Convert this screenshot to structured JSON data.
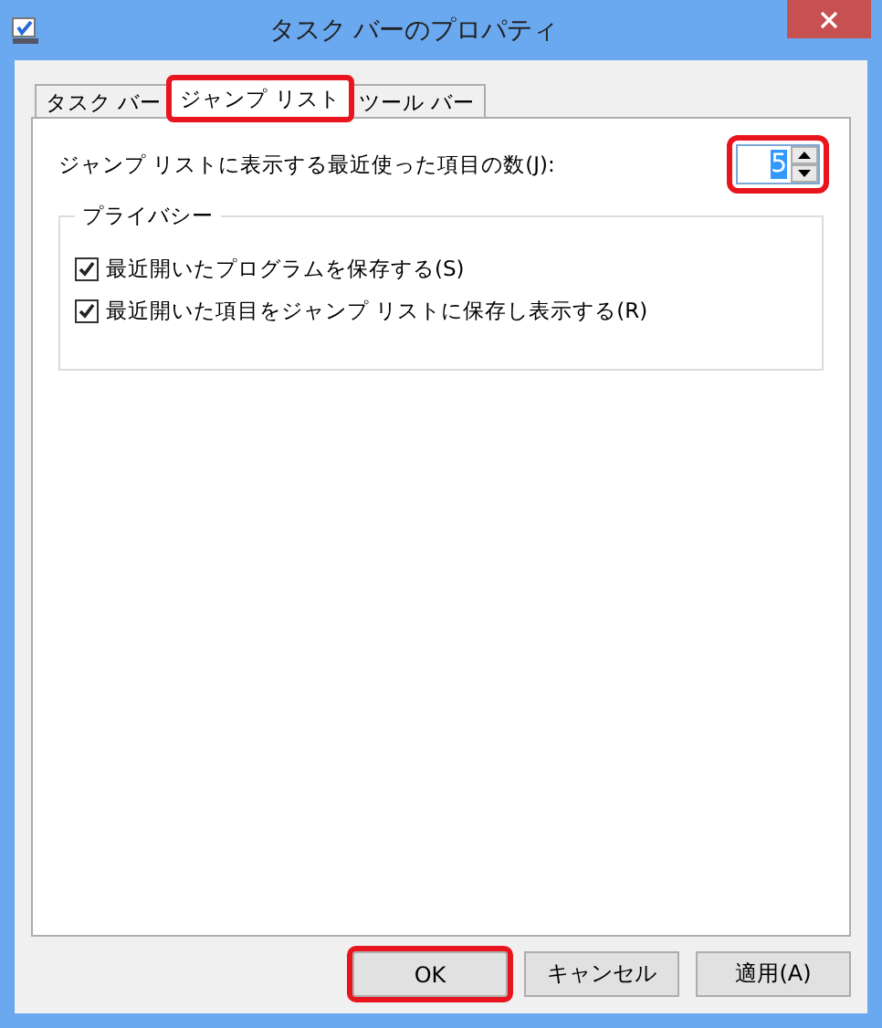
{
  "window": {
    "title": "タスク バーのプロパティ"
  },
  "tabs": [
    {
      "label": "タスク バー",
      "selected": false,
      "highlighted": false
    },
    {
      "label": "ジャンプ リスト",
      "selected": true,
      "highlighted": true
    },
    {
      "label": "ツール バー",
      "selected": false,
      "highlighted": false
    }
  ],
  "recent_count": {
    "label": "ジャンプ リストに表示する最近使った項目の数(J):",
    "value": "5",
    "highlighted": true
  },
  "privacy": {
    "title": "プライバシー",
    "options": [
      {
        "label": "最近開いたプログラムを保存する(S)",
        "checked": true
      },
      {
        "label": "最近開いた項目をジャンプ リストに保存し表示する(R)",
        "checked": true
      }
    ]
  },
  "buttons": [
    {
      "label": "OK",
      "highlighted": true
    },
    {
      "label": "キャンセル",
      "highlighted": false
    },
    {
      "label": "適用(A)",
      "highlighted": false
    }
  ]
}
